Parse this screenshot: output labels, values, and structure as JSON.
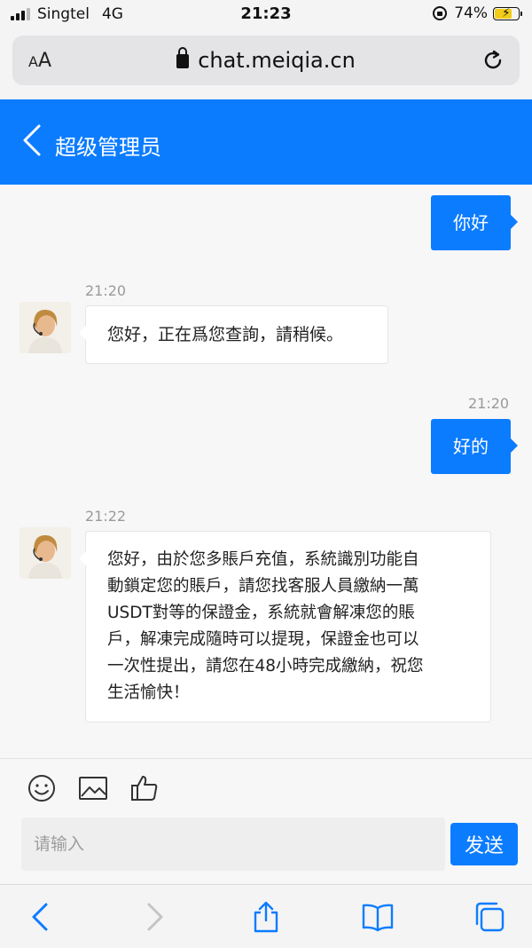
{
  "status_bar": {
    "carrier": "Singtel",
    "network": "4G",
    "time": "21:23",
    "battery": "74%",
    "battery_level": 0.74
  },
  "browser": {
    "text_size_label_small": "A",
    "text_size_label_large": "A",
    "url": "chat.meiqia.cn"
  },
  "header": {
    "title": "超级管理员"
  },
  "messages": [
    {
      "from": "me",
      "text": "你好"
    },
    {
      "from": "agent",
      "time": "21:20",
      "text": "您好，正在爲您查詢，請稍候。"
    },
    {
      "from": "me",
      "time": "21:20",
      "text": "好的"
    },
    {
      "from": "agent",
      "time": "21:22",
      "lines": [
        "您好，由於您多賬戶充值，系統識別功能自",
        "動鎖定您的賬戶，請您找客服人員繳納一萬",
        "USDT對等的保證金，系統就會解凍您的賬",
        "戶，解凍完成隨時可以提現，保證金也可以",
        "一次性提出，請您在48小時完成繳納，祝您",
        "生活愉快！"
      ]
    }
  ],
  "composer": {
    "placeholder": "请输入",
    "send_label": "发送"
  },
  "colors": {
    "accent": "#0c7cff",
    "background": "#f7f7f7"
  },
  "icons": [
    "emoji-icon",
    "image-icon",
    "thumbs-up-icon",
    "back-arrow-icon",
    "forward-arrow-icon",
    "share-icon",
    "bookmarks-icon",
    "tabs-icon",
    "reload-icon",
    "padlock-icon"
  ]
}
